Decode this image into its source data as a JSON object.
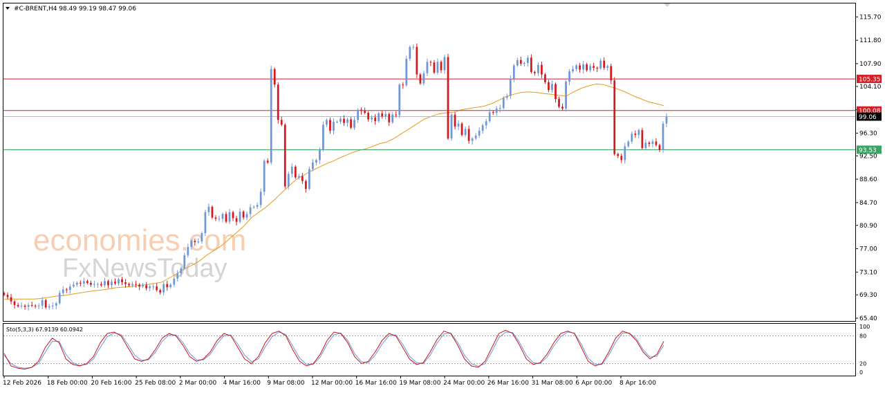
{
  "header": {
    "symbol_text": "#C-BRENT,H4  98.49 99.19 98.47 99.06"
  },
  "watermark": {
    "line1": "economies.com",
    "line2": "FxNewsToday"
  },
  "indicator": {
    "label": "Sto(5,3,3) 67.9139 60.0942",
    "levels": [
      "100",
      "80",
      "20",
      "0"
    ]
  },
  "colors": {
    "bull": "#6f97d6",
    "bear": "#d4181f",
    "ma": "#e49b1a",
    "resistance": "#d41f26",
    "support": "#2f9e5a",
    "current": "#000000",
    "stoch_main": "#c8141c",
    "stoch_signal": "#6f97d6"
  },
  "chart_data": {
    "type": "candlestick",
    "title": "#C-BRENT,H4",
    "last_bar": {
      "open": 98.49,
      "high": 99.19,
      "low": 98.47,
      "close": 99.06
    },
    "ylim": [
      65.4,
      117.6
    ],
    "y_ticks": [
      "115.70",
      "111.80",
      "107.90",
      "104.10",
      "100.20",
      "96.30",
      "92.50",
      "88.60",
      "84.70",
      "80.90",
      "77.00",
      "73.10",
      "69.30",
      "65.40"
    ],
    "x_ticks": [
      "12 Feb 2026",
      "18 Feb 00:00",
      "20 Feb 16:00",
      "25 Feb 08:00",
      "2 Mar 00:00",
      "4 Mar 16:00",
      "9 Mar 08:00",
      "12 Mar 00:00",
      "16 Mar 16:00",
      "19 Mar 08:00",
      "24 Mar 00:00",
      "26 Mar 16:00",
      "31 Mar 08:00",
      "6 Apr 00:00",
      "8 Apr 16:00"
    ],
    "levels": [
      {
        "label": "105.35",
        "value": 105.35,
        "kind": "resistance"
      },
      {
        "label": "100.08",
        "value": 100.08,
        "kind": "resistance"
      },
      {
        "label": "99.06",
        "value": 99.06,
        "kind": "current"
      },
      {
        "label": "93.53",
        "value": 93.53,
        "kind": "support"
      }
    ],
    "closes": [
      69.3,
      68.9,
      68.2,
      67.6,
      67.4,
      67.5,
      67.3,
      67.6,
      67.5,
      67.4,
      67.5,
      68.4,
      67.2,
      67.4,
      67.5,
      67.9,
      69.6,
      70.2,
      70.1,
      70.7,
      71.0,
      71.3,
      71.2,
      71.6,
      71.3,
      71.0,
      71.1,
      71.1,
      70.9,
      71.6,
      70.9,
      71.5,
      71.2,
      71.9,
      71.4,
      71.1,
      70.9,
      71.1,
      71.0,
      70.7,
      70.9,
      70.4,
      70.7,
      70.7,
      70.1,
      69.7,
      71.1,
      70.6,
      71.0,
      72.0,
      72.9,
      73.7,
      75.9,
      77.3,
      78.3,
      78.1,
      78.2,
      79.6,
      83.1,
      84.0,
      82.2,
      82.0,
      82.0,
      82.8,
      81.5,
      83.1,
      82.1,
      81.5,
      83.2,
      82.2,
      82.8,
      83.9,
      84.0,
      84.3,
      86.5,
      91.7,
      91.4,
      107.0,
      104.4,
      98.5,
      97.7,
      87.4,
      89.5,
      90.7,
      88.9,
      89.1,
      88.3,
      87.0,
      90.3,
      91.4,
      91.8,
      93.5,
      97.7,
      98.5,
      96.7,
      98.2,
      98.2,
      98.7,
      98.0,
      98.6,
      97.2,
      98.5,
      100.2,
      100.0,
      99.7,
      98.6,
      98.9,
      98.3,
      99.6,
      99.1,
      99.5,
      98.1,
      99.4,
      99.3,
      104.4,
      104.3,
      108.7,
      110.7,
      110.7,
      106.1,
      104.6,
      106.3,
      108.2,
      108.1,
      106.4,
      108.2,
      106.8,
      109.0,
      95.4,
      99.4,
      97.4,
      97.9,
      96.0,
      97.0,
      95.0,
      95.4,
      95.9,
      96.7,
      97.6,
      98.3,
      99.8,
      99.7,
      100.4,
      100.5,
      102.2,
      102.5,
      105.4,
      107.6,
      108.5,
      107.9,
      108.0,
      108.9,
      106.5,
      106.3,
      107.7,
      106.1,
      104.8,
      103.5,
      104.5,
      102.0,
      100.7,
      100.4,
      104.9,
      106.6,
      107.0,
      107.6,
      106.9,
      107.8,
      106.8,
      107.5,
      107.2,
      107.1,
      108.4,
      107.2,
      107.5,
      105.1,
      92.8,
      92.5,
      91.8,
      94.1,
      94.9,
      96.2,
      96.0,
      96.8,
      93.8,
      94.7,
      94.5,
      94.9,
      94.3,
      93.5,
      97.9,
      99.06
    ],
    "moving_average": {
      "name": "",
      "values": [
        68.6,
        68.6,
        68.6,
        68.6,
        68.6,
        68.7,
        68.9,
        69.1,
        69.2,
        69.4,
        69.6,
        69.8,
        70.0,
        70.1,
        70.3,
        70.5,
        70.6,
        70.7,
        70.9,
        71.0,
        71.2,
        71.4,
        72.1,
        72.8,
        73.6,
        74.2,
        74.9,
        75.9,
        76.7,
        77.5,
        78.6,
        79.7,
        80.8,
        82.2,
        83.1,
        84.0,
        85.1,
        86.3,
        87.5,
        88.6,
        89.3,
        90.0,
        90.6,
        91.2,
        91.7,
        92.3,
        92.8,
        93.3,
        93.6,
        94.0,
        94.5,
        94.8,
        95.4,
        96.2,
        97.0,
        97.8,
        98.6,
        99.1,
        99.5,
        99.7,
        99.8,
        100.2,
        100.4,
        100.6,
        100.8,
        101.2,
        101.8,
        102.4,
        102.8,
        103.1,
        103.2,
        103.1,
        102.9,
        102.8,
        102.6,
        102.5,
        103.2,
        103.8,
        104.2,
        104.5,
        104.4,
        104.0,
        103.6,
        103.1,
        102.5,
        102.0,
        101.5,
        101.2,
        100.9
      ]
    },
    "stochastic": {
      "main": [
        42,
        15,
        10,
        8,
        12,
        25,
        55,
        75,
        65,
        30,
        18,
        15,
        20,
        35,
        65,
        85,
        88,
        80,
        55,
        30,
        25,
        30,
        50,
        75,
        85,
        80,
        60,
        35,
        25,
        30,
        45,
        70,
        85,
        80,
        55,
        30,
        20,
        35,
        65,
        85,
        90,
        80,
        50,
        25,
        15,
        20,
        40,
        70,
        88,
        85,
        65,
        35,
        20,
        25,
        45,
        70,
        85,
        80,
        55,
        30,
        18,
        22,
        45,
        72,
        90,
        85,
        60,
        30,
        15,
        12,
        25,
        55,
        85,
        92,
        85,
        60,
        30,
        18,
        22,
        40,
        65,
        85,
        90,
        85,
        55,
        25,
        15,
        20,
        45,
        75,
        90,
        85,
        70,
        45,
        30,
        40,
        68
      ],
      "signal": [
        38,
        20,
        12,
        10,
        12,
        20,
        45,
        68,
        68,
        40,
        22,
        16,
        18,
        30,
        55,
        78,
        86,
        83,
        62,
        38,
        27,
        28,
        44,
        68,
        82,
        82,
        66,
        42,
        28,
        28,
        40,
        63,
        80,
        82,
        62,
        38,
        24,
        30,
        56,
        78,
        88,
        83,
        58,
        32,
        18,
        18,
        34,
        62,
        82,
        86,
        70,
        42,
        24,
        22,
        38,
        62,
        80,
        82,
        62,
        36,
        22,
        20,
        38,
        64,
        84,
        86,
        66,
        38,
        20,
        14,
        20,
        46,
        76,
        88,
        87,
        66,
        38,
        22,
        20,
        34,
        58,
        78,
        88,
        86,
        62,
        32,
        18,
        18,
        38,
        66,
        86,
        86,
        74,
        50,
        34,
        36,
        60
      ]
    }
  }
}
